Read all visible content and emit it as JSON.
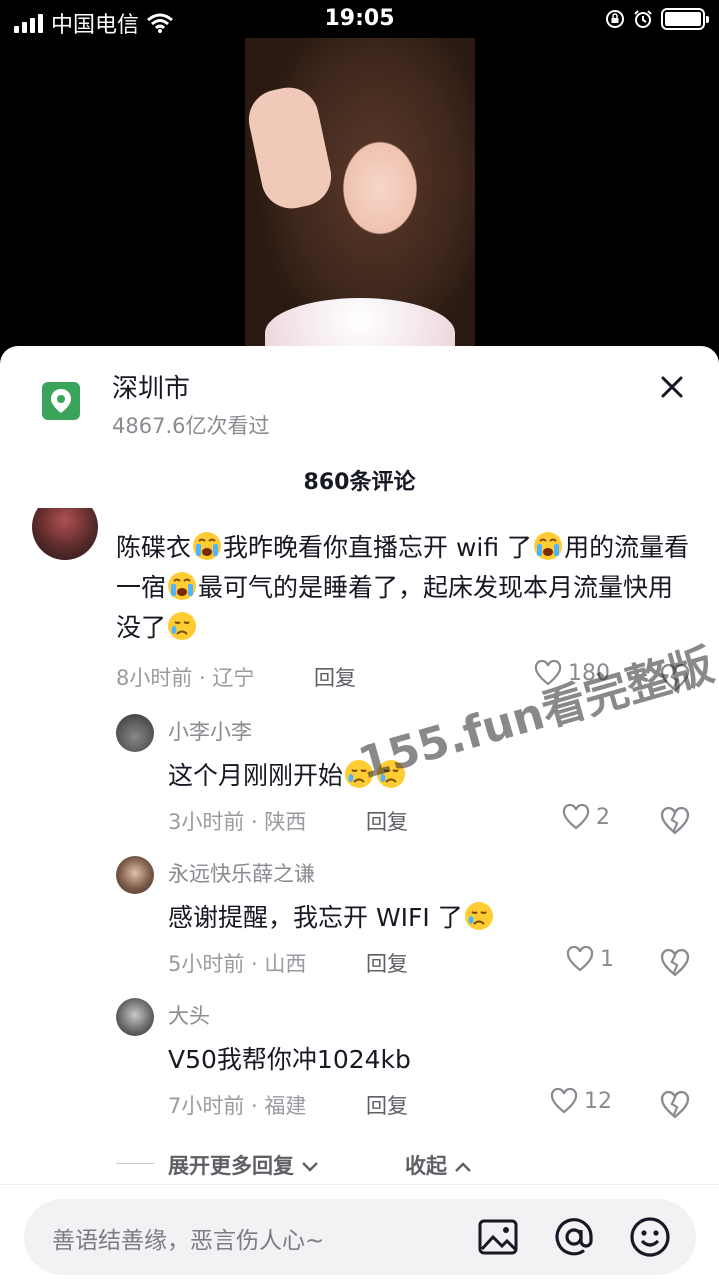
{
  "status_bar": {
    "carrier": "中国电信",
    "time": "19:05"
  },
  "location": {
    "title": "深圳市",
    "views": "4867.6亿次看过"
  },
  "comment_count": "860条评论",
  "comments": {
    "main": {
      "text_1": "陈碟衣",
      "text_2": "我昨晚看你直播忘开 wifi 了",
      "text_3": "用的流量看一宿",
      "text_4": "最可气的是睡着了，起床发现本月流量快用没了",
      "meta": "8小时前 · 辽宁",
      "reply_label": "回复",
      "likes": "180"
    },
    "replies": [
      {
        "name": "小李小李",
        "text": "这个月刚刚开始",
        "meta": "3小时前 · 陕西",
        "reply_label": "回复",
        "likes": "2"
      },
      {
        "name": "永远快乐薛之谦",
        "text": "感谢提醒，我忘开 WIFI 了",
        "meta": "5小时前 · 山西",
        "reply_label": "回复",
        "likes": "1"
      },
      {
        "name": "大头",
        "text": "V50我帮你冲1024kb",
        "meta": "7小时前 · 福建",
        "reply_label": "回复",
        "likes": "12"
      }
    ]
  },
  "expand_more": "展开更多回复",
  "collapse": "收起",
  "input": {
    "placeholder": "善语结善缘，恶言伤人心~"
  },
  "watermark": "155.fun看完整版",
  "colors": {
    "location_green": "#3aa45a",
    "text_primary": "#161823",
    "text_secondary": "#8a8b91"
  }
}
